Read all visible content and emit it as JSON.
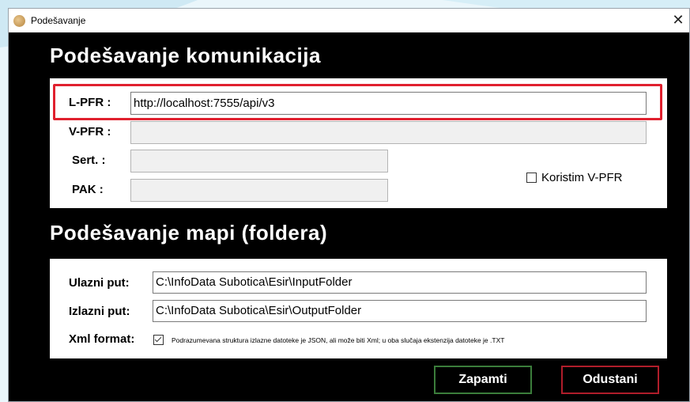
{
  "window": {
    "title": "Podešavanje",
    "close_glyph": "✕"
  },
  "communication": {
    "title": "Podešavanje komunikacija",
    "lpfr_label": "L-PFR :",
    "lpfr_value": "http://localhost:7555/api/v3",
    "vpfr_label": "V-PFR :",
    "vpfr_value": "",
    "sert_label": "Sert. :",
    "sert_value": "",
    "pak_label": "PAK :",
    "pak_value": "",
    "use_vpfr_label": "Koristim V-PFR",
    "use_vpfr_checked": false
  },
  "folders": {
    "title": "Podešavanje mapi (foldera)",
    "input_label": "Ulazni put:",
    "input_value": "C:\\InfoData Subotica\\Esir\\InputFolder",
    "output_label": "Izlazni put:",
    "output_value": "C:\\InfoData Subotica\\Esir\\OutputFolder",
    "xml_label": "Xml format:",
    "xml_checked": true,
    "xml_note": "Podrazumevana struktura izlazne datoteke je JSON, ali može biti Xml; u oba slučaja ekstenzija datoteke je .TXT"
  },
  "buttons": {
    "save": "Zapamti",
    "cancel": "Odustani"
  },
  "colors": {
    "highlight": "#e0202e",
    "save_border": "#3b7d3b",
    "cancel_border": "#b01d2a"
  }
}
